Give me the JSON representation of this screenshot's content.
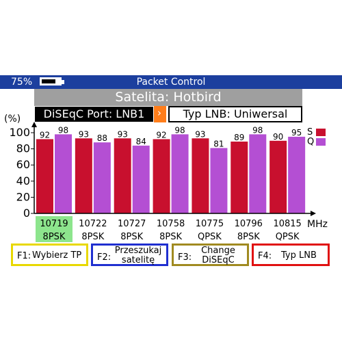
{
  "status": {
    "battery_percent": "75%",
    "battery_level": 0.75,
    "title": "Packet Control"
  },
  "satellite_title": "Satelita: Hotbird",
  "diseqc": {
    "label": "DiSEqC Port: LNB1",
    "arrow": "›"
  },
  "lnb_type": "Typ LNB: Uniwersal",
  "chart_data": {
    "type": "bar",
    "ylabel": "(%)",
    "xlabel": "MHz",
    "ylim": [
      0,
      100
    ],
    "yticks": [
      0,
      20,
      40,
      60,
      80,
      100
    ],
    "categories": [
      "10719",
      "10722",
      "10727",
      "10758",
      "10775",
      "10796",
      "10815"
    ],
    "modulations": [
      "8PSK",
      "8PSK",
      "8PSK",
      "8PSK",
      "QPSK",
      "8PSK",
      "QPSK"
    ],
    "selected_index": 0,
    "series": [
      {
        "name": "S",
        "color": "#c8102e",
        "values": [
          92,
          93,
          93,
          92,
          93,
          89,
          90
        ]
      },
      {
        "name": "Q",
        "color": "#b44fd3",
        "values": [
          98,
          88,
          84,
          98,
          81,
          98,
          95
        ]
      }
    ],
    "legend_placement": "top-right"
  },
  "function_keys": [
    {
      "key": "F1:",
      "label": "Wybierz TP",
      "color": "#e8d800"
    },
    {
      "key": "F2:",
      "label": "Przeszukaj satelitę",
      "color": "#1f2fd0"
    },
    {
      "key": "F3:",
      "label": "Change DiSEqC",
      "color": "#a08a20"
    },
    {
      "key": "F4:",
      "label": "Typ LNB",
      "color": "#e01010"
    }
  ]
}
